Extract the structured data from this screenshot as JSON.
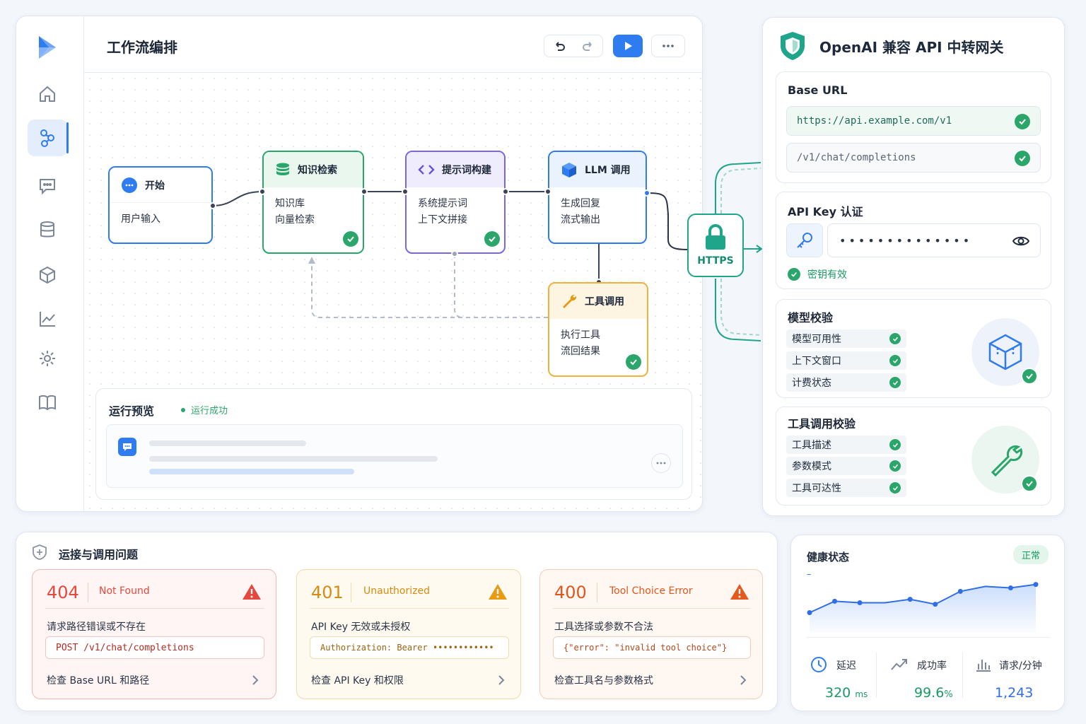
{
  "editor": {
    "title": "工作流编排",
    "sidebar": [
      "logo-icon",
      "home-icon",
      "workflow-icon",
      "chat-icon",
      "database-icon",
      "cube-icon",
      "chart-icon",
      "gear-icon",
      "book-icon"
    ],
    "nodes": {
      "start": {
        "title": "开始",
        "body": [
          "用户输入"
        ]
      },
      "knowledge": {
        "title": "知识检索",
        "body": [
          "知识库",
          "向量检索"
        ]
      },
      "prompt": {
        "title": "提示词构建",
        "body": [
          "系统提示词",
          "上下文拼接"
        ]
      },
      "llm": {
        "title": "LLM 调用",
        "body": [
          "生成回复",
          "流式输出"
        ]
      },
      "tool": {
        "title": "工具调用",
        "body": [
          "执行工具",
          "流回结果"
        ]
      }
    },
    "https_label": "HTTPS",
    "preview": {
      "title": "运行预览",
      "status": "运行成功"
    }
  },
  "gateway": {
    "title": "OpenAI 兼容 API 中转网关",
    "base_url": {
      "title": "Base URL",
      "url": "https://api.example.com/v1",
      "path": "/v1/chat/completions"
    },
    "api_key": {
      "title": "API Key 认证",
      "masked": "••••••••••••••",
      "status": "密钥有效"
    },
    "model_check": {
      "title": "模型校验",
      "items": [
        "模型可用性",
        "上下文窗口",
        "计费状态"
      ]
    },
    "tool_check": {
      "title": "工具调用校验",
      "items": [
        "工具描述",
        "参数模式",
        "工具可达性"
      ]
    }
  },
  "errors": {
    "title": "运接与调用问题",
    "cards": [
      {
        "code": "404",
        "name": "Not Found",
        "desc": "请求路径错误或不存在",
        "snippet": "POST  /v1/chat/completions",
        "action": "检查 Base URL 和路径",
        "color": "#e5483d"
      },
      {
        "code": "401",
        "name": "Unauthorized",
        "desc": "API Key 无效或未授权",
        "snippet": "Authorization: Bearer ••••••••••••",
        "action": "检查 API Key 和权限",
        "color": "#d98a10"
      },
      {
        "code": "400",
        "name": "Tool Choice Error",
        "desc": "工具选择或参数不合法",
        "snippet": "{\"error\": \"invalid tool choice\"}",
        "action": "检查工具名与参数格式",
        "color": "#e0561d"
      }
    ]
  },
  "health": {
    "title": "健康状态",
    "badge": "正常",
    "legend": "–",
    "trend": [
      0.35,
      0.58,
      0.55,
      0.55,
      0.62,
      0.52,
      0.78,
      0.88,
      0.85,
      0.92
    ],
    "metrics": [
      {
        "label": "延迟",
        "value": "320",
        "unit": "ms"
      },
      {
        "label": "成功率",
        "value": "99.6",
        "unit": "%"
      },
      {
        "label": "请求/分钟",
        "value": "1,243",
        "unit": ""
      }
    ]
  }
}
